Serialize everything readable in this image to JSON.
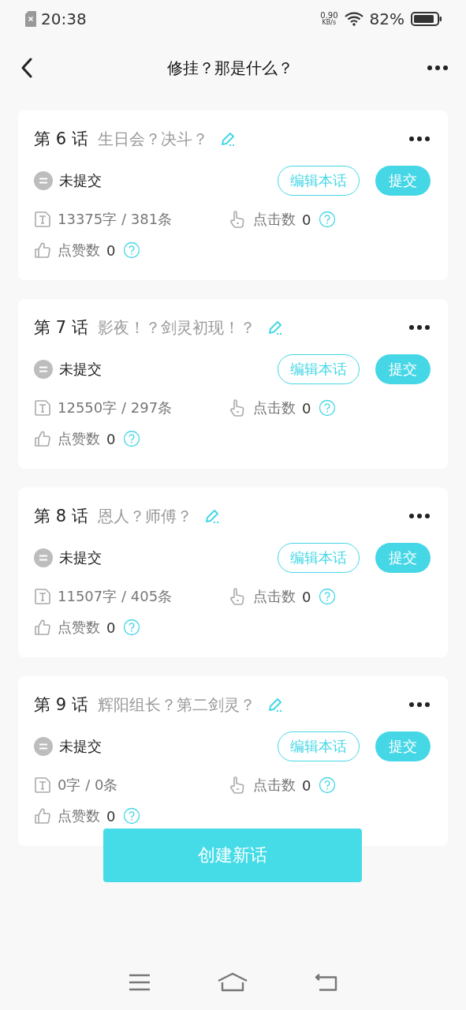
{
  "status_bar": {
    "time": "20:38",
    "net_speed_value": "0.90",
    "net_speed_unit": "KB/s",
    "battery": "82%"
  },
  "header": {
    "title": "修挂？那是什么？"
  },
  "chapters": [
    {
      "number": "第 6 话",
      "name": "生日会？决斗？",
      "status": "未提交",
      "edit_button": "编辑本话",
      "submit_button": "提交",
      "words": "13375字 / 381条",
      "clicks_label": "点击数",
      "clicks": "0",
      "likes_label": "点赞数",
      "likes": "0"
    },
    {
      "number": "第 7 话",
      "name": "影夜！？剑灵初现！？",
      "status": "未提交",
      "edit_button": "编辑本话",
      "submit_button": "提交",
      "words": "12550字 / 297条",
      "clicks_label": "点击数",
      "clicks": "0",
      "likes_label": "点赞数",
      "likes": "0"
    },
    {
      "number": "第 8 话",
      "name": "恩人？师傅？",
      "status": "未提交",
      "edit_button": "编辑本话",
      "submit_button": "提交",
      "words": "11507字 / 405条",
      "clicks_label": "点击数",
      "clicks": "0",
      "likes_label": "点赞数",
      "likes": "0"
    },
    {
      "number": "第 9 话",
      "name": "辉阳组长？第二剑灵？",
      "status": "未提交",
      "edit_button": "编辑本话",
      "submit_button": "提交",
      "words": "0字 / 0条",
      "clicks_label": "点击数",
      "clicks": "0",
      "likes_label": "点赞数",
      "likes": "0"
    }
  ],
  "create_button": "创建新话"
}
